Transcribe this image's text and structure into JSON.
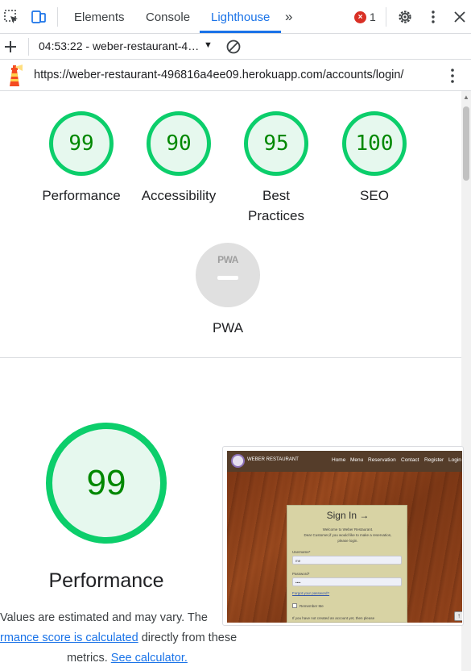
{
  "devtools": {
    "tabs": [
      {
        "label": "Elements"
      },
      {
        "label": "Console"
      },
      {
        "label": "Lighthouse"
      }
    ],
    "more_tabs": "»",
    "error_count": "1",
    "error_badge": "×",
    "report_title": "04:53:22 - weber-restaurant-4…",
    "url": "https://weber-restaurant-496816a4ee09.herokuapp.com/accounts/login/"
  },
  "scores": [
    {
      "value": "99",
      "label": "Performance"
    },
    {
      "value": "90",
      "label": "Accessibility"
    },
    {
      "value": "95",
      "label": "Best Practices"
    },
    {
      "value": "100",
      "label": "SEO"
    }
  ],
  "pwa": {
    "logo_text": "PWA",
    "label": "PWA"
  },
  "performance": {
    "value": "99",
    "title": "Performance",
    "desc_line1": "Values are estimated and may vary. The",
    "desc_link1": "rmance score is calculated",
    "desc_line2_rest": " directly from these",
    "desc_line3_pre": "metrics. ",
    "desc_link2": "See calculator."
  },
  "thumbnail": {
    "brand": "WEBER RESTAURANT",
    "nav": [
      "Home",
      "Menu",
      "Reservation",
      "Contact",
      "Register",
      "Login"
    ],
    "card_title": "Sign In →",
    "welcome": "Welcome to Weber Restaurant.",
    "instructions_1": "Dear Customer,if you would like to make a reservation,",
    "instructions_2": "please login.",
    "username_label": "Username*",
    "username_value": "me",
    "password_label": "Password*",
    "password_value": "••••",
    "forgot": "Forgot your password?",
    "remember": "Remember Me",
    "signup": "If you have not created an account yet, then please"
  },
  "colors": {
    "pass_green": "#0cce6b",
    "pass_text": "#008800",
    "accent_blue": "#1a73e8",
    "error_red": "#d93025"
  }
}
